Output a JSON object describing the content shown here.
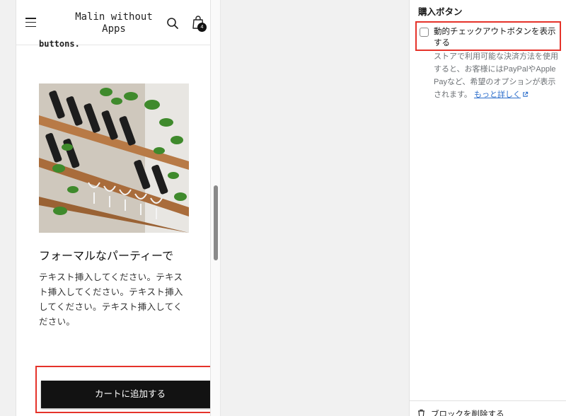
{
  "header": {
    "store_title": "Malin without Apps",
    "cart_count": "4"
  },
  "content": {
    "clipped_text": "buttons.",
    "heading": "フォーマルなパーティーで",
    "body": "テキスト挿入してください。テキスト挿入してください。テキスト挿入してください。テキスト挿入してください。",
    "add_to_cart_label": "カートに追加する"
  },
  "panel": {
    "section_title": "購入ボタン",
    "dynamic_checkout_label": "動的チェックアウトボタンを表示する",
    "dynamic_checkout_checked": false,
    "help_text": "ストアで利用可能な決済方法を使用すると、お客様にはPayPalやApple Payなど、希望のオプションが表示されます。",
    "learn_more_link": "もっと詳しく",
    "remove_block_label": "ブロックを削除する"
  },
  "colors": {
    "highlight": "#e5332a",
    "button": "#121212",
    "link": "#2c6ecb"
  },
  "icons": [
    "menu-icon",
    "search-icon",
    "cart-bag-icon",
    "external-link-icon",
    "trash-icon"
  ]
}
